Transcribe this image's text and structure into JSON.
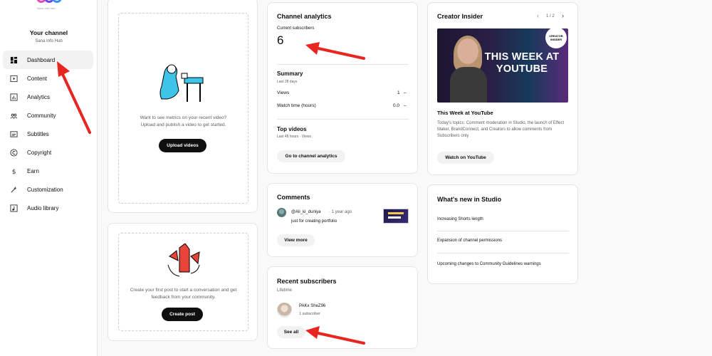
{
  "channel": {
    "logo_sub": "Sana Info Hub",
    "title": "Your channel",
    "name": "Sana Info Hub"
  },
  "nav": [
    {
      "label": "Dashboard",
      "icon": "dashboard-icon",
      "active": true
    },
    {
      "label": "Content",
      "icon": "content-icon"
    },
    {
      "label": "Analytics",
      "icon": "analytics-icon"
    },
    {
      "label": "Community",
      "icon": "community-icon"
    },
    {
      "label": "Subtitles",
      "icon": "subtitles-icon"
    },
    {
      "label": "Copyright",
      "icon": "copyright-icon"
    },
    {
      "label": "Earn",
      "icon": "earn-icon"
    },
    {
      "label": "Customization",
      "icon": "customization-icon"
    },
    {
      "label": "Audio library",
      "icon": "audio-library-icon"
    }
  ],
  "upload_card": {
    "text": "Want to see metrics on your recent video? Upload and publish a video to get started.",
    "button": "Upload videos"
  },
  "post_card": {
    "text": "Create your first post to start a conversation and get feedback from your community.",
    "button": "Create post"
  },
  "analytics": {
    "title": "Channel analytics",
    "current_label": "Current subscribers",
    "current_value": "6",
    "summary_title": "Summary",
    "summary_sub": "Last 28 days",
    "views_label": "Views",
    "views_value": "1",
    "watch_label": "Watch time (hours)",
    "watch_value": "0.0",
    "dash": "–",
    "top_title": "Top videos",
    "top_sub": "Last 48 hours · Views",
    "button": "Go to channel analytics"
  },
  "comments": {
    "title": "Comments",
    "author": "@Ali_ki_duniya",
    "time": "· 1 year ago",
    "text": "just for creating portfolio",
    "button": "View more"
  },
  "recent_subs": {
    "title": "Recent subscribers",
    "sub": "Lifetime",
    "name": "PAKx SheZ96",
    "count": "1 subscriber",
    "button": "See all"
  },
  "insider": {
    "title": "Creator Insider",
    "pager": "1 / 2",
    "thumb_text": "THIS WEEK AT YOUTUBE",
    "badge": "CREATOR INSIDER",
    "video_title": "This Week at YouTube",
    "desc": "Today's topics: Comment moderation in Studio, the launch of Effect Maker, BrandConnect, and Creators to allow comments from Subscribers only",
    "button": "Watch on YouTube"
  },
  "whats_new": {
    "title": "What's new in Studio",
    "items": [
      "Increasing Shorts length",
      "Expansion of channel permissions",
      "Upcoming changes to Community Guidelines warnings"
    ]
  },
  "colors": {
    "accent": "#065fd4",
    "annotation_arrow": "#e8261f",
    "button_dark": "#0f0f0f",
    "button_light": "#f2f2f2"
  }
}
